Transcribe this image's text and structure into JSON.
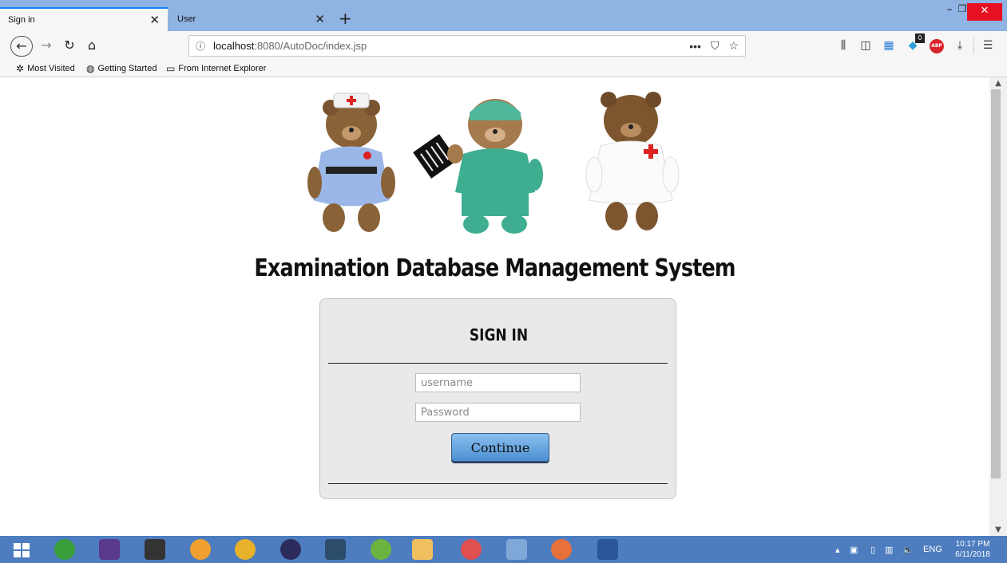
{
  "browser": {
    "tabs": [
      {
        "label": "Sign in",
        "active": true
      },
      {
        "label": "User",
        "active": false
      }
    ],
    "url": {
      "host": "localhost",
      "path": ":8080/AutoDoc/index.jsp"
    },
    "bookmarks": [
      {
        "label": "Most Visited",
        "icon": "gear-icon"
      },
      {
        "label": "Getting Started",
        "icon": "globe-icon"
      },
      {
        "label": "From Internet Explorer",
        "icon": "folder-icon"
      }
    ],
    "ext_badge": "0",
    "abp_label": "ABP"
  },
  "page": {
    "title": "Examination Database Management System",
    "signin": {
      "heading": "SIGN IN",
      "username_placeholder": "username",
      "password_placeholder": "Password",
      "continue_label": "Continue"
    }
  },
  "taskbar": {
    "lang": "ENG",
    "time": "10:17 PM",
    "date": "6/11/2018"
  },
  "colors": {
    "tabbar": "#8fb3e3",
    "button_top": "#8ac0ef",
    "button_bottom": "#4b8fd1",
    "taskbar": "#4d7dbf",
    "close": "#e81123"
  }
}
